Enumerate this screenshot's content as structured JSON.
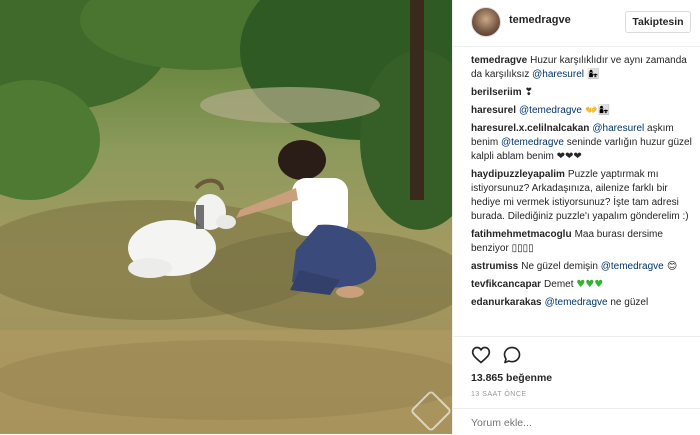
{
  "header": {
    "username": "temedragve",
    "follow_label": "Takiptesin"
  },
  "comments": [
    {
      "user": "temedragve",
      "parts": [
        {
          "t": "Huzur karşılıklıdır ve aynı zamanda da karşılıksız "
        },
        {
          "m": "@haresurel"
        },
        {
          "e": " 👩‍👧"
        }
      ]
    },
    {
      "user": "berilseriim",
      "parts": [
        {
          "e": "❣"
        }
      ]
    },
    {
      "user": "haresurel",
      "parts": [
        {
          "m": "@temedragve"
        },
        {
          "e": " 👐👩‍👧"
        }
      ]
    },
    {
      "user": "haresurel.x.celilnalcakan",
      "parts": [
        {
          "m": "@haresurel"
        },
        {
          "t": " aşkım benim "
        },
        {
          "m": "@temedragve"
        },
        {
          "t": " seninde varlığın huzur güzel kalpli ablam benim "
        },
        {
          "e": "❤❤❤"
        }
      ]
    },
    {
      "user": "haydipuzzleyapalim",
      "parts": [
        {
          "t": "Puzzle yaptırmak mı istiyorsunuz? Arkadaşınıza, ailenize farklı bir hediye mi vermek istiyorsunuz? İşte tam adresi burada. Dilediğiniz puzzle'ı yapalım gönderelim :)"
        }
      ]
    },
    {
      "user": "fatihmehmetmacoglu",
      "parts": [
        {
          "t": "Maa burası dersime benziyor "
        },
        {
          "e": "▯▯▯▯"
        }
      ]
    },
    {
      "user": "astrumiss",
      "parts": [
        {
          "t": "Ne güzel demişin "
        },
        {
          "m": "@temedragve"
        },
        {
          "e": " 😊"
        }
      ]
    },
    {
      "user": "tevfikcancapar",
      "parts": [
        {
          "t": "Demet "
        },
        {
          "g": "♥♥♥"
        }
      ]
    },
    {
      "user": "edanurkarakas",
      "parts": [
        {
          "m": "@temedragve"
        },
        {
          "t": " ne güzel"
        }
      ]
    }
  ],
  "actions": {
    "like_icon": "heart-icon",
    "comment_icon": "comment-icon"
  },
  "likes": "13.865 beğenme",
  "timestamp": "13 SAAT ÖNCE",
  "add_comment_placeholder": "Yorum ekle...",
  "colors": {
    "mention": "#003569",
    "green_heart": "#34b233"
  }
}
